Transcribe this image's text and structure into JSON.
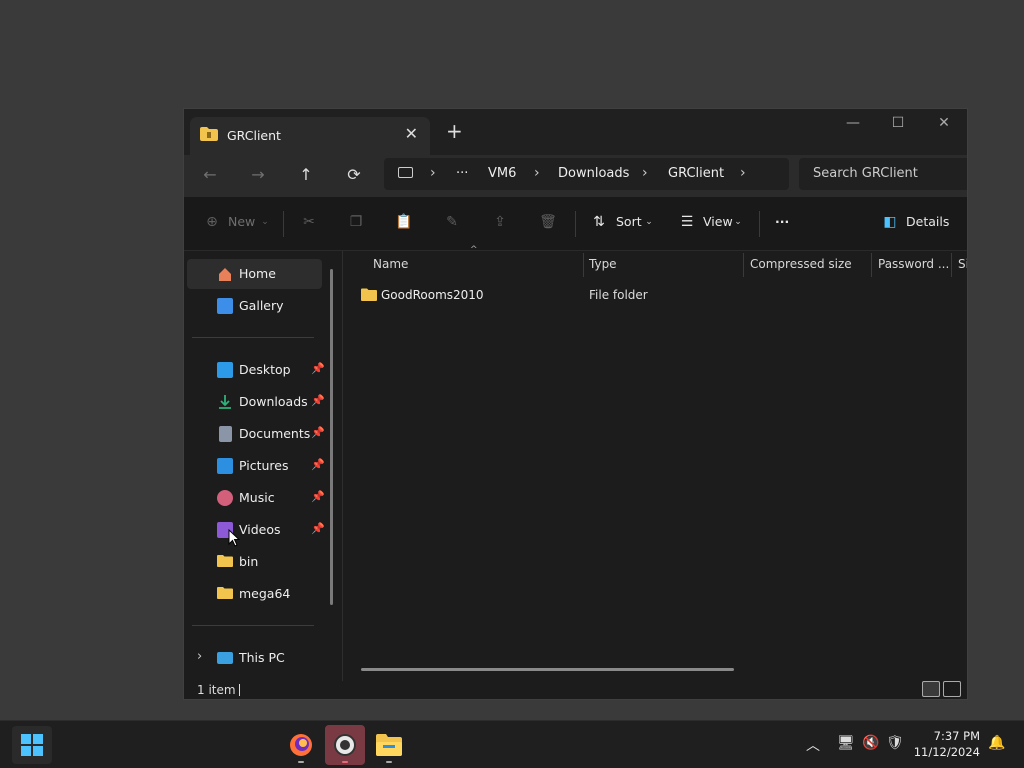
{
  "tab": {
    "title": "GRClient",
    "close": "✕",
    "new": "+"
  },
  "window_controls": {
    "minimize": "—",
    "maximize": "☐",
    "close": "✕"
  },
  "nav": {
    "back": "←",
    "forward": "→",
    "up": "↑",
    "refresh": "⟳"
  },
  "address": {
    "more": "···",
    "crumbs": [
      "VM6",
      "Downloads",
      "GRClient"
    ]
  },
  "search": {
    "placeholder": "Search GRClient"
  },
  "toolbar": {
    "new_label": "New",
    "sort_label": "Sort",
    "view_label": "View",
    "more": "···",
    "details_label": "Details"
  },
  "sidebar": {
    "items": [
      {
        "label": "Home",
        "icon": "home-icon",
        "color": "#e8805a"
      },
      {
        "label": "Gallery",
        "icon": "gallery-icon",
        "color": "#3c8ee8"
      },
      {
        "label": "Desktop",
        "icon": "desktop-icon",
        "color": "#2d9ae8"
      },
      {
        "label": "Downloads",
        "icon": "download-icon",
        "color": "#2fb17a"
      },
      {
        "label": "Documents",
        "icon": "document-icon",
        "color": "#8a96a8"
      },
      {
        "label": "Pictures",
        "icon": "pictures-icon",
        "color": "#2d8fe0"
      },
      {
        "label": "Music",
        "icon": "music-icon",
        "color": "#d2607a"
      },
      {
        "label": "Videos",
        "icon": "videos-icon",
        "color": "#8c5ad6"
      },
      {
        "label": "bin",
        "icon": "folder-icon",
        "color": "#f2c44d"
      },
      {
        "label": "mega64",
        "icon": "folder-icon",
        "color": "#f2c44d"
      },
      {
        "label": "This PC",
        "icon": "this-pc-icon",
        "color": "#3aa0e0"
      }
    ]
  },
  "columns": {
    "name": "Name",
    "type": "Type",
    "compressed_size": "Compressed size",
    "password": "Password ...",
    "size": "Si"
  },
  "files": [
    {
      "name": "GoodRooms2010",
      "type": "File folder"
    }
  ],
  "status": {
    "count": "1 item"
  },
  "clock": {
    "time": "7:37 PM",
    "date": "11/12/2024"
  },
  "colors": {
    "accent": "#4cc2ff",
    "folder": "#f2c44d",
    "window_bg": "#1c1c1c",
    "desktop_bg": "#3a3a3a"
  }
}
